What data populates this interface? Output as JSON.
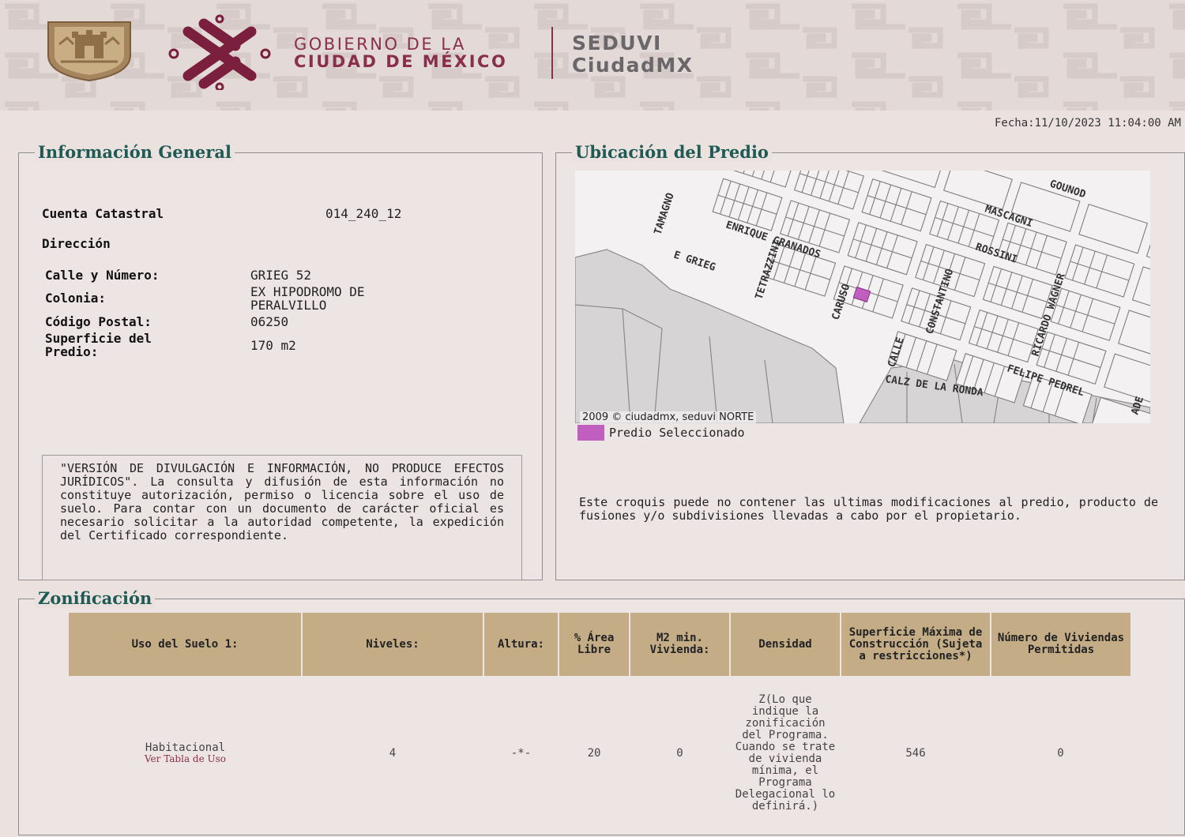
{
  "header": {
    "gov_line1": "GOBIERNO DE LA",
    "gov_line2": "CIUDAD DE MÉXICO",
    "app_line1": "SEDUVI",
    "app_line2": "CiudadMX",
    "brand_color": "#8a2f4b",
    "shield_icon": "coat-of-arms-icon",
    "logo_icon": "cdmx-knot-logo-icon"
  },
  "fecha": "Fecha:11/10/2023 11:04:00 AM",
  "general": {
    "title": "Información General",
    "cuenta_label": "Cuenta Catastral",
    "cuenta_value": "014_240_12",
    "direccion_label": "Dirección",
    "calle_label": "Calle y Número:",
    "calle_value": "GRIEG 52",
    "colonia_label": "Colonia:",
    "colonia_value_line1": "EX HIPODROMO DE",
    "colonia_value_line2": "PERALVILLO",
    "cp_label": "Código Postal:",
    "cp_value": "06250",
    "superficie_label_line1": "Superficie del",
    "superficie_label_line2": "Predio:",
    "superficie_value": "170 m2",
    "disclaimer": "\"VERSIÓN DE DIVULGACIÓN E INFORMACIÓN, NO PRODUCE EFECTOS JURÍDICOS\". La consulta y difusión de esta información no constituye autorización, permiso o licencia sobre el uso de suelo. Para contar con un documento de carácter oficial es necesario solicitar a la autoridad competente, la expedición del Certificado correspondiente."
  },
  "ubicacion": {
    "title": "Ubicación del Predio",
    "map_copyright": "2009 © ciudadmx, seduvi NORTE",
    "legend_label": "Predio Seleccionado",
    "legend_color": "#c05fc0",
    "note": "Este croquis puede no contener las ultimas modificaciones al predio, producto de fusiones y/o subdivisiones llevadas a cabo por el propietario.",
    "streets": {
      "gounod": "GOUNOD",
      "mascagni": "MASCAGNI",
      "tamagno": "TAMAGNO",
      "enrique_granados": "ENRIQUE GRANADOS",
      "rossini": "ROSSINI",
      "e_grieg": "E GRIEG",
      "tetrazzini": "TETRAZZINI",
      "caruso": "CARUSO",
      "constantino": "CONSTANTINO",
      "ricardo_wagner": "RICARDO WAGNER",
      "calle": "CALLE",
      "felipe_pedrel": "FELIPE PEDREL",
      "calz_ronda": "CALZ DE LA RONDA",
      "ade": "ADE"
    }
  },
  "zonificacion": {
    "title": "Zonificación",
    "headers": [
      "Uso del Suelo 1:",
      "Niveles:",
      "Altura:",
      "% Área Libre",
      "M2 min. Vivienda:",
      "Densidad",
      "Superficie Máxima de Construcción (Sujeta a restricciones*)",
      "Número de Viviendas Permitidas"
    ],
    "row": {
      "uso": "Habitacional",
      "uso_link": "Ver Tabla de Uso",
      "niveles": "4",
      "altura": "-*-",
      "area_libre": "20",
      "m2_min": "0",
      "densidad": "Z(Lo que indique la zonificación del Programa. Cuando se trate de vivienda mínima, el Programa Delegacional lo definirá.)",
      "superficie_max": "546",
      "num_viviendas": "0"
    }
  }
}
